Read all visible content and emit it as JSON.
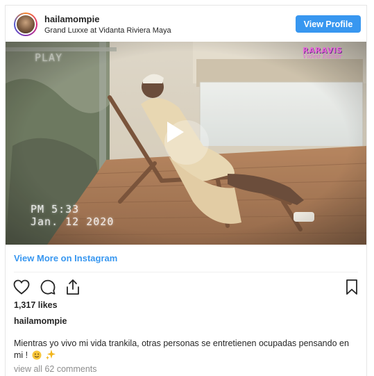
{
  "header": {
    "username": "hailamompie",
    "location": "Grand Luxxe at Vidanta Riviera Maya",
    "view_profile_label": "View Profile",
    "accent_color": "#3897f0"
  },
  "media": {
    "play_label": "PLAY",
    "time_stamp": "PM 5:33",
    "date_stamp": "Jan. 12 2020",
    "brand_name": "RARAVIS",
    "brand_sub": "Video Editor",
    "icon": "play-icon"
  },
  "view_more_label": "View More on Instagram",
  "actions": {
    "like": "heart-icon",
    "comment": "comment-icon",
    "share": "share-icon",
    "save": "bookmark-icon"
  },
  "likes_text": "1,317 likes",
  "caption": {
    "username": "hailamompie",
    "text": "Mientras yo vivo mi vida trankila, otras personas se entretienen ocupadas pensando en mi !"
  },
  "comments_text": "view all 62 comments"
}
